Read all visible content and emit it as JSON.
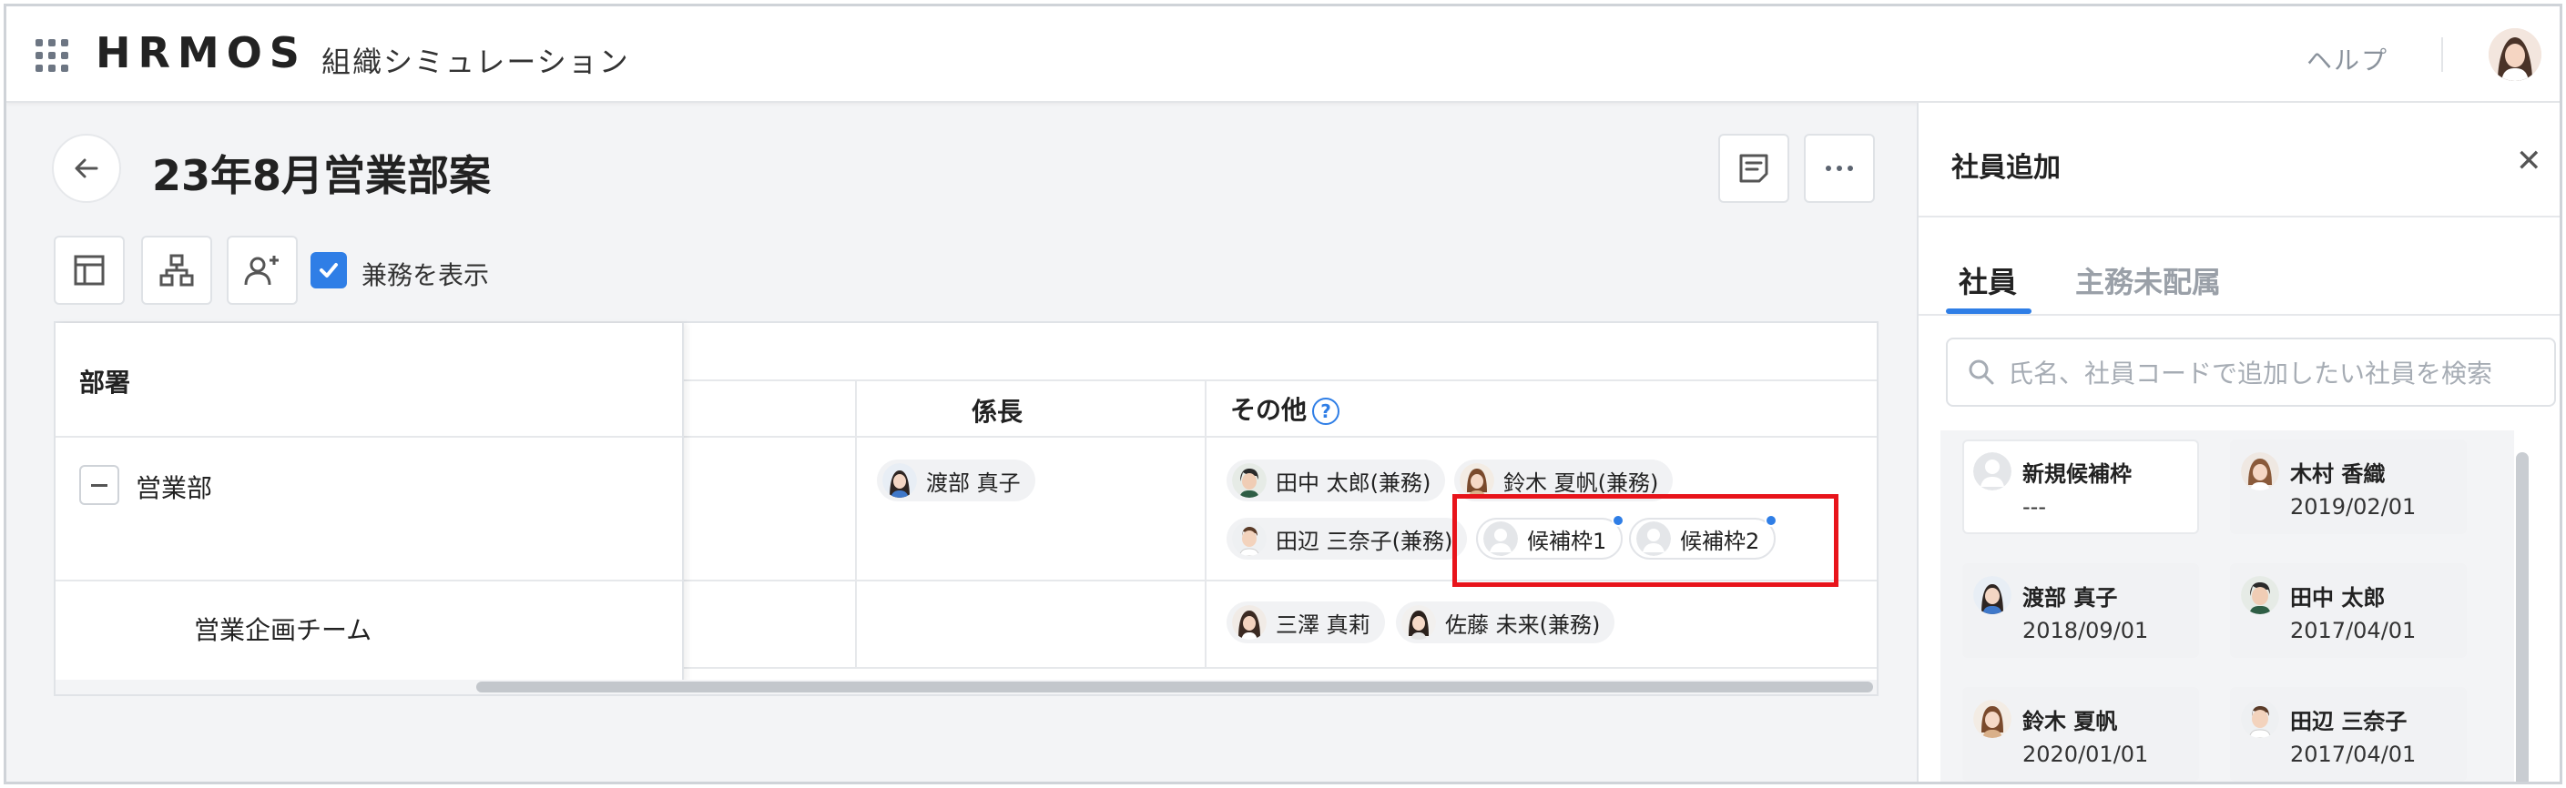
{
  "header": {
    "logo": "HRMOS",
    "app_name": "組織シミュレーション",
    "help": "ヘルプ"
  },
  "page": {
    "title": "23年8月営業部案",
    "show_concurrent_label": "兼務を表示"
  },
  "table": {
    "col_department": "部署",
    "col_chief": "係長",
    "col_other": "その他",
    "rows": [
      {
        "department": "営業部",
        "chief": "渡部 真子",
        "others": [
          "田中 太郎(兼務)",
          "鈴木 夏帆(兼務)",
          "田辺 三奈子(兼務)"
        ],
        "candidates": [
          "候補枠1",
          "候補枠2"
        ]
      },
      {
        "department": "営業企画チーム",
        "others": [
          "三澤 真莉",
          "佐藤 未来(兼務)"
        ]
      }
    ]
  },
  "panel": {
    "title": "社員追加",
    "tabs": [
      "社員",
      "主務未配属"
    ],
    "search_placeholder": "氏名、社員コードで追加したい社員を検索",
    "cards": [
      {
        "name": "新規候補枠",
        "date": "---"
      },
      {
        "name": "木村 香織",
        "date": "2019/02/01"
      },
      {
        "name": "渡部 真子",
        "date": "2018/09/01"
      },
      {
        "name": "田中 太郎",
        "date": "2017/04/01"
      },
      {
        "name": "鈴木 夏帆",
        "date": "2020/01/01"
      },
      {
        "name": "田辺 三奈子",
        "date": "2017/04/01"
      }
    ]
  },
  "colors": {
    "accent": "#2f7ee6",
    "highlight": "#e8141b"
  }
}
